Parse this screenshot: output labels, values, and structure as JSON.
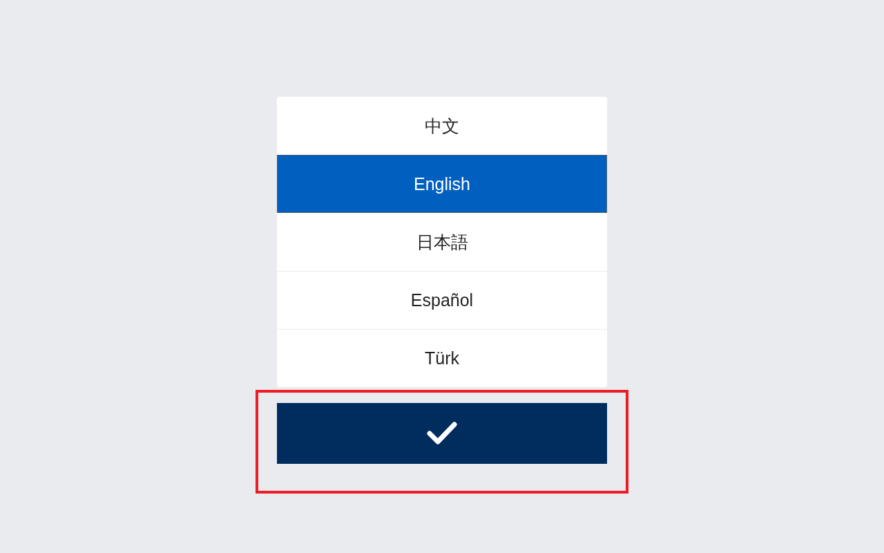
{
  "languages": [
    {
      "label": "中文",
      "selected": false
    },
    {
      "label": "English",
      "selected": true
    },
    {
      "label": "日本語",
      "selected": false
    },
    {
      "label": "Español",
      "selected": false
    },
    {
      "label": "Türk",
      "selected": false
    }
  ],
  "confirm_button": {
    "highlighted": true
  }
}
